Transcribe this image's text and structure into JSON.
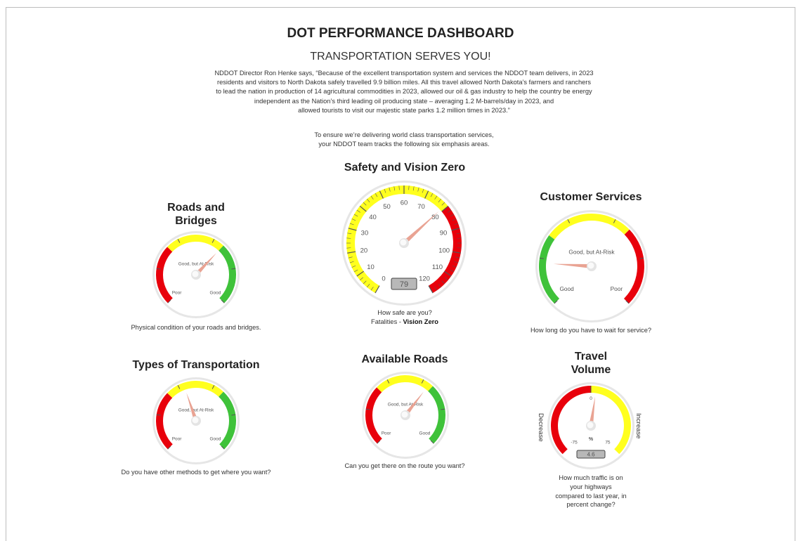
{
  "header": {
    "title": "DOT PERFORMANCE DASHBOARD",
    "subtitle": "TRANSPORTATION SERVES YOU!",
    "intro_lines": [
      "NDDOT Director Ron Henke says, “Because of the excellent transportation system and services the NDDOT team delivers, in 2023",
      "residents and visitors to North Dakota safely travelled 9.9 billion miles. All this travel allowed North Dakota’s farmers and ranchers",
      "to lead the nation in production of 14 agricultural commodities in 2023, allowed our oil & gas industry to help the country be energy",
      "independent as the Nation’s third leading oil producing state – averaging 1.2 M-barrels/day in 2023, and",
      "allowed tourists to visit our majestic state parks 1.2 million times in 2023.”"
    ],
    "emphasis_lines": [
      "To ensure we’re delivering world class transportation services,",
      "your NDDOT team tracks the following six emphasis areas."
    ]
  },
  "gauges": {
    "roads_bridges": {
      "title_lines": [
        "Roads and",
        "Bridges"
      ],
      "caption": "Physical condition of your roads and bridges.",
      "label_left": "Poor",
      "label_mid": "Good, but At-Risk",
      "label_right": "Good",
      "needle_fraction": 0.66
    },
    "safety": {
      "title": "Safety and Vision Zero",
      "caption_line1": "How safe are you?",
      "caption_prefix": "Fatalities - ",
      "caption_bold": "Vision Zero",
      "min": 0,
      "max": 120,
      "ticks": [
        "0",
        "10",
        "20",
        "30",
        "40",
        "50",
        "60",
        "70",
        "80",
        "90",
        "100",
        "110",
        "120"
      ],
      "yellow_until": 80,
      "value": 79,
      "display": "79"
    },
    "customer": {
      "title": "Customer Services",
      "caption": "How long do you have to wait for service?",
      "label_left": "Good",
      "label_mid": "Good, but At-Risk",
      "label_right": "Poor",
      "needle_fraction": 0.18
    },
    "types": {
      "title": "Types of Transportation",
      "caption": "Do you have other methods to get where you want?",
      "label_left": "Poor",
      "label_mid": "Good, but At-Risk",
      "label_right": "Good",
      "needle_fraction": 0.43
    },
    "available": {
      "title": "Available Roads",
      "caption": "Can you get there on the route you want?",
      "label_left": "Poor",
      "label_mid": "Good, but At-Risk",
      "label_right": "Good",
      "needle_fraction": 0.64
    },
    "travel": {
      "title_lines": [
        "Travel",
        "Volume"
      ],
      "caption_lines": [
        "How much traffic is on",
        "your highways",
        "compared to last year, in",
        "percent change?"
      ],
      "side_left": "Decrease",
      "side_right": "Increase",
      "min_label": "-75",
      "mid_label": "0",
      "max_label": "75",
      "unit": "%",
      "min": -75,
      "max": 75,
      "value": 4.6,
      "display": "4.6"
    }
  },
  "colors": {
    "red": "#e8000b",
    "yellow": "#ffff1e",
    "green": "#3fc23a",
    "needle": "#e9a393",
    "bezel": "#dcdcdc"
  }
}
